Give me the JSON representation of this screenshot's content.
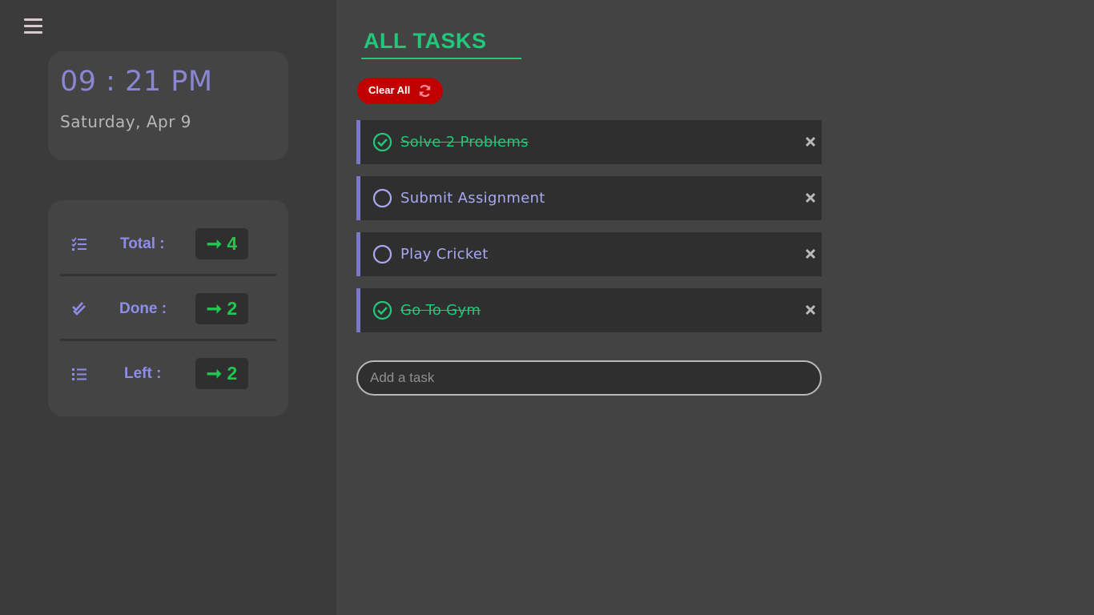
{
  "sidebar": {
    "clock": {
      "time": "09 : 21 PM",
      "date": "Saturday, Apr 9"
    },
    "stats": [
      {
        "label": "Total :",
        "value": "➞ 4",
        "icon": "tasks-checklist-icon"
      },
      {
        "label": "Done :",
        "value": "➞ 2",
        "icon": "double-check-icon"
      },
      {
        "label": "Left :",
        "value": "➞ 2",
        "icon": "list-icon"
      }
    ]
  },
  "main": {
    "title": "ALL TASKS",
    "clear_label": "Clear All",
    "tasks": [
      {
        "text": "Solve 2 Problems",
        "done": true
      },
      {
        "text": "Submit Assignment",
        "done": false
      },
      {
        "text": "Play Cricket",
        "done": false
      },
      {
        "text": "Go To Gym",
        "done": true
      }
    ],
    "add_placeholder": "Add a task"
  },
  "colors": {
    "accent_green": "#22c87a",
    "accent_purple": "#8a86d4",
    "danger_red": "#c00000",
    "background": "#434343",
    "sidebar_bg": "#3b3b3b"
  }
}
